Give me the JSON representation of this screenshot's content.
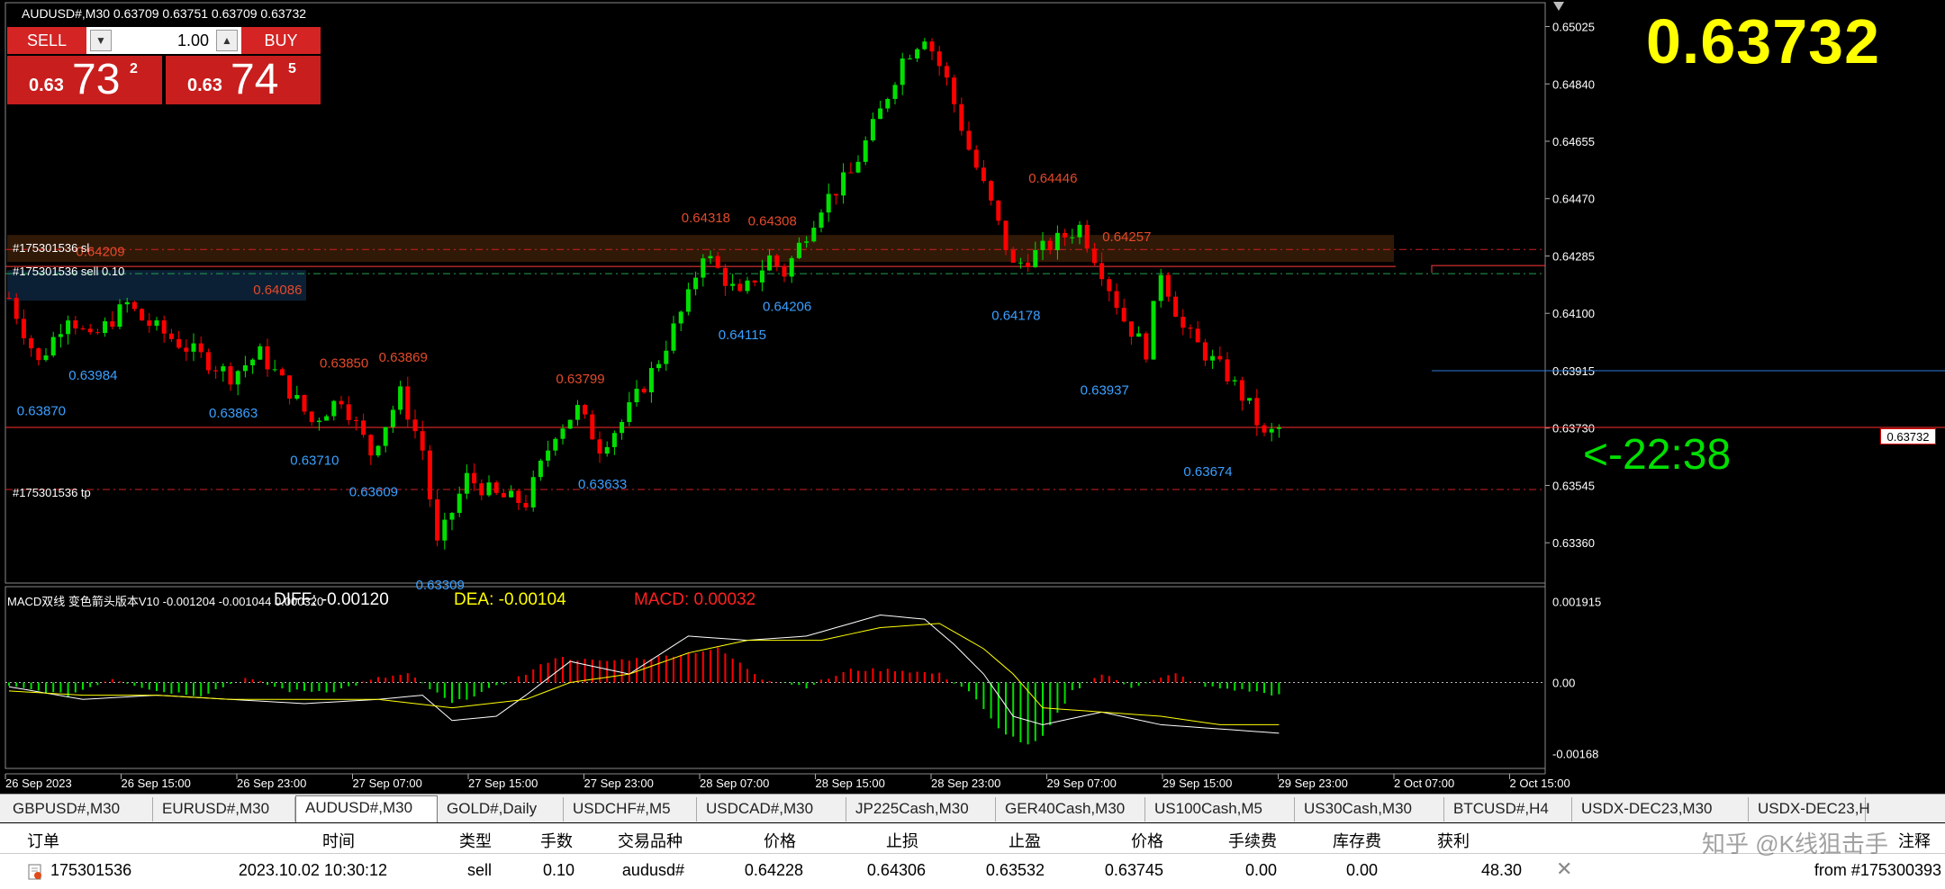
{
  "window": {
    "symbol_info": "AUDUSD#,M30  0.63709 0.63751 0.63709 0.63732"
  },
  "trade_panel": {
    "sell_label": "SELL",
    "buy_label": "BUY",
    "lot_value": "1.00",
    "sell_quote": {
      "small": "0.63",
      "big": "73",
      "sup": "2"
    },
    "buy_quote": {
      "small": "0.63",
      "big": "74",
      "sup": "5"
    }
  },
  "big_price": "0.63732",
  "countdown": "<-22:38",
  "current_price_tag": "0.63732",
  "order_lines": {
    "sl_label": "#175301536 sl",
    "sell_label": "#175301536 sell 0.10",
    "tp_label": "#175301536 tp"
  },
  "macd": {
    "title": "MACD双线 变色箭头版本V10 -0.001204 -0.001044 0.000320",
    "diff_label": "DIFF: -0.00120",
    "dea_label": "DEA: -0.00104",
    "macd_label": "MACD: 0.00032",
    "axis": [
      "0.001915",
      "0.00",
      "-0.00168"
    ]
  },
  "colors": {
    "bull": "#00e000",
    "bear": "#ff0000",
    "high_label": "#e34a2a",
    "low_label": "#3aa0ff",
    "accent_yellow": "#ffff00",
    "panel_red": "#d42424"
  },
  "chart_data": {
    "type": "candlestick",
    "symbol": "AUDUSD#",
    "timeframe": "M30",
    "y_ticks": [
      "0.65025",
      "0.64840",
      "0.64655",
      "0.64470",
      "0.64285",
      "0.64100",
      "0.63915",
      "0.63730",
      "0.63545",
      "0.63360"
    ],
    "ylim": [
      0.6323,
      0.6507
    ],
    "x_ticks": [
      "26 Sep 2023",
      "26 Sep 15:00",
      "26 Sep 23:00",
      "27 Sep 07:00",
      "27 Sep 15:00",
      "27 Sep 23:00",
      "28 Sep 07:00",
      "28 Sep 15:00",
      "28 Sep 23:00",
      "29 Sep 07:00",
      "29 Sep 15:00",
      "29 Sep 23:00",
      "2 Oct 07:00",
      "2 Oct 15:00"
    ],
    "candle_count": 190,
    "highs": [
      {
        "i": 12,
        "label": "0.64209"
      },
      {
        "i": 36,
        "label": "0.64086"
      },
      {
        "i": 45,
        "label": "0.63850"
      },
      {
        "i": 53,
        "label": "0.63869"
      },
      {
        "i": 77,
        "label": "0.63799"
      },
      {
        "i": 94,
        "label": "0.64318"
      },
      {
        "i": 103,
        "label": "0.64308"
      },
      {
        "i": 141,
        "label": "0.64446"
      },
      {
        "i": 151,
        "label": "0.64257"
      }
    ],
    "lows": [
      {
        "i": 4,
        "label": "0.63870"
      },
      {
        "i": 11,
        "label": "0.63984"
      },
      {
        "i": 30,
        "label": "0.63863"
      },
      {
        "i": 41,
        "label": "0.63710"
      },
      {
        "i": 49,
        "label": "0.63609"
      },
      {
        "i": 58,
        "label": "0.63309"
      },
      {
        "i": 80,
        "label": "0.63633"
      },
      {
        "i": 99,
        "label": "0.64115"
      },
      {
        "i": 105,
        "label": "0.64206"
      },
      {
        "i": 136,
        "label": "0.64178"
      },
      {
        "i": 148,
        "label": "0.63937"
      },
      {
        "i": 162,
        "label": "0.63674"
      }
    ],
    "path": [
      [
        0,
        0.6415
      ],
      [
        4,
        0.6394
      ],
      [
        8,
        0.641
      ],
      [
        11,
        0.6401
      ],
      [
        16,
        0.6413
      ],
      [
        18,
        0.6408
      ],
      [
        22,
        0.6402
      ],
      [
        26,
        0.6396
      ],
      [
        30,
        0.639
      ],
      [
        34,
        0.6397
      ],
      [
        38,
        0.6385
      ],
      [
        41,
        0.6375
      ],
      [
        45,
        0.6383
      ],
      [
        49,
        0.6365
      ],
      [
        53,
        0.6384
      ],
      [
        56,
        0.6366
      ],
      [
        58,
        0.6335
      ],
      [
        62,
        0.6357
      ],
      [
        66,
        0.6351
      ],
      [
        70,
        0.6349
      ],
      [
        74,
        0.6372
      ],
      [
        77,
        0.6379
      ],
      [
        80,
        0.6367
      ],
      [
        83,
        0.6375
      ],
      [
        88,
        0.6395
      ],
      [
        92,
        0.6415
      ],
      [
        94,
        0.643
      ],
      [
        99,
        0.6415
      ],
      [
        103,
        0.6428
      ],
      [
        105,
        0.6423
      ],
      [
        110,
        0.6445
      ],
      [
        114,
        0.6455
      ],
      [
        118,
        0.6475
      ],
      [
        121,
        0.6492
      ],
      [
        124,
        0.65
      ],
      [
        127,
        0.6485
      ],
      [
        130,
        0.6463
      ],
      [
        133,
        0.6445
      ],
      [
        136,
        0.6425
      ],
      [
        141,
        0.6432
      ],
      [
        145,
        0.6438
      ],
      [
        148,
        0.6424
      ],
      [
        151,
        0.6408
      ],
      [
        154,
        0.6398
      ],
      [
        156,
        0.6424
      ],
      [
        159,
        0.6405
      ],
      [
        162,
        0.6397
      ],
      [
        165,
        0.639
      ],
      [
        168,
        0.638
      ],
      [
        170,
        0.637
      ],
      [
        172,
        0.6373
      ]
    ],
    "current": 0.63732,
    "levels": {
      "sl": 0.64306,
      "entry": 0.64228,
      "tp": 0.63532,
      "bid": 0.63732,
      "blue_line": 0.63915,
      "high_box": 0.6426
    },
    "macd": {
      "ylim": [
        -0.00195,
        0.0021
      ],
      "hist": [
        [
          0,
          -0.0001
        ],
        [
          8,
          -0.0003
        ],
        [
          14,
          0.0001
        ],
        [
          20,
          -0.0002
        ],
        [
          26,
          -0.0003
        ],
        [
          32,
          0.0001
        ],
        [
          38,
          -0.0002
        ],
        [
          44,
          -0.0002
        ],
        [
          50,
          0.0001
        ],
        [
          54,
          0.0002
        ],
        [
          60,
          -0.0005
        ],
        [
          66,
          -0.0001
        ],
        [
          70,
          0.0002
        ],
        [
          74,
          0.0006
        ],
        [
          80,
          0.0005
        ],
        [
          88,
          0.0006
        ],
        [
          96,
          0.0008
        ],
        [
          102,
          0.0001
        ],
        [
          108,
          -0.0001
        ],
        [
          114,
          0.0003
        ],
        [
          120,
          0.0003
        ],
        [
          126,
          0.0002
        ],
        [
          130,
          -0.0002
        ],
        [
          134,
          -0.0011
        ],
        [
          138,
          -0.0015
        ],
        [
          140,
          -0.0013
        ],
        [
          144,
          -0.0002
        ],
        [
          148,
          0.0002
        ],
        [
          152,
          -0.0001
        ],
        [
          158,
          0.0002
        ],
        [
          162,
          -0.0001
        ],
        [
          168,
          -0.0002
        ],
        [
          172,
          -0.0003
        ]
      ],
      "diff": [
        [
          0,
          -0.0001
        ],
        [
          10,
          -0.0004
        ],
        [
          20,
          -0.0003
        ],
        [
          30,
          -0.0004
        ],
        [
          40,
          -0.0005
        ],
        [
          50,
          -0.0004
        ],
        [
          56,
          -0.0003
        ],
        [
          60,
          -0.0009
        ],
        [
          66,
          -0.0008
        ],
        [
          70,
          -0.0003
        ],
        [
          76,
          0.0005
        ],
        [
          84,
          0.0002
        ],
        [
          92,
          0.0011
        ],
        [
          100,
          0.001
        ],
        [
          108,
          0.0011
        ],
        [
          118,
          0.0016
        ],
        [
          124,
          0.0015
        ],
        [
          128,
          0.0009
        ],
        [
          132,
          0.0002
        ],
        [
          136,
          -0.0008
        ],
        [
          140,
          -0.001
        ],
        [
          148,
          -0.0007
        ],
        [
          156,
          -0.001
        ],
        [
          164,
          -0.0011
        ],
        [
          172,
          -0.0012
        ]
      ],
      "dea": [
        [
          0,
          -0.0002
        ],
        [
          10,
          -0.0003
        ],
        [
          20,
          -0.0003
        ],
        [
          30,
          -0.0004
        ],
        [
          40,
          -0.0004
        ],
        [
          50,
          -0.0004
        ],
        [
          60,
          -0.0006
        ],
        [
          70,
          -0.0004
        ],
        [
          76,
          0.0
        ],
        [
          84,
          0.0002
        ],
        [
          92,
          0.0007
        ],
        [
          100,
          0.001
        ],
        [
          110,
          0.001
        ],
        [
          118,
          0.0013
        ],
        [
          126,
          0.0014
        ],
        [
          132,
          0.0008
        ],
        [
          136,
          0.0002
        ],
        [
          140,
          -0.0006
        ],
        [
          148,
          -0.0007
        ],
        [
          156,
          -0.0008
        ],
        [
          164,
          -0.001
        ],
        [
          172,
          -0.001
        ]
      ]
    }
  },
  "tabs": [
    "GBPUSD#,M30",
    "EURUSD#,M30",
    "AUDUSD#,M30",
    "GOLD#,Daily",
    "USDCHF#,M5",
    "USDCAD#,M30",
    "JP225Cash,M30",
    "GER40Cash,M30",
    "US100Cash,M5",
    "US30Cash,M30",
    "BTCUSD#,H4",
    "USDX-DEC23,M30",
    "USDX-DEC23,H"
  ],
  "active_tab": 2,
  "orders": {
    "headers": [
      "订单",
      "时间",
      "类型",
      "手数",
      "交易品种",
      "价格",
      "止损",
      "止盈",
      "价格",
      "手续费",
      "库存费",
      "获利",
      "注释"
    ],
    "row": [
      "175301536",
      "2023.10.02 10:30:12",
      "sell",
      "0.10",
      "audusd#",
      "0.64228",
      "0.64306",
      "0.63532",
      "0.63745",
      "0.00",
      "0.00",
      "48.30",
      "from #175300393"
    ]
  },
  "watermark": "知乎 @K线狙击手"
}
